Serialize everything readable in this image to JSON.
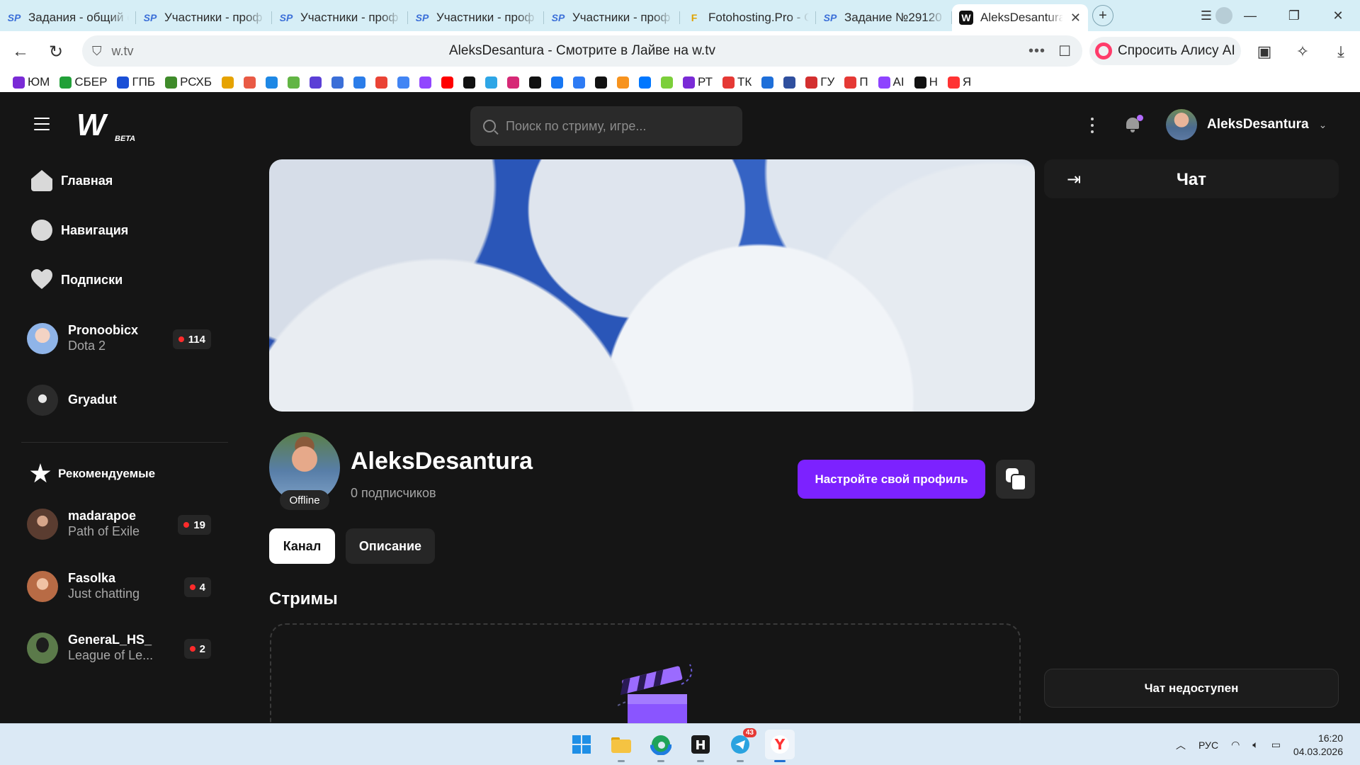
{
  "browser": {
    "tabs": [
      {
        "title": "Задания - общий с",
        "favicon": "SP",
        "active": false
      },
      {
        "title": "Участники - проф",
        "favicon": "SP",
        "active": false
      },
      {
        "title": "Участники - проф",
        "favicon": "SP",
        "active": false
      },
      {
        "title": "Участники - проф",
        "favicon": "SP",
        "active": false
      },
      {
        "title": "Участники - проф",
        "favicon": "SP",
        "active": false
      },
      {
        "title": "Fotohosting.Pro - С",
        "favicon": "F",
        "active": false
      },
      {
        "title": "Задание №29120",
        "favicon": "SP",
        "active": false
      },
      {
        "title": "AleksDesantura",
        "favicon": "W",
        "active": true
      }
    ],
    "new_tab": "+",
    "url": "w.tv",
    "page_title": "AleksDesantura - Смотрите в Лайве на w.tv",
    "alice_label": "Спросить Алису AI",
    "bookmarks": [
      {
        "label": "ЮМ",
        "color": "#7a2bd6"
      },
      {
        "label": "СБЕР",
        "color": "#21a038"
      },
      {
        "label": "ГПБ",
        "color": "#1a4fd6"
      },
      {
        "label": "РСХБ",
        "color": "#3f8b2a"
      },
      {
        "label": "",
        "color": "#e6a300"
      },
      {
        "label": "",
        "color": "#e95a45"
      },
      {
        "label": "",
        "color": "#1e88e5"
      },
      {
        "label": "",
        "color": "#62b544"
      },
      {
        "label": "",
        "color": "#5b3fd6"
      },
      {
        "label": "",
        "color": "#3b6fd8"
      },
      {
        "label": "",
        "color": "#2b7de9"
      },
      {
        "label": "",
        "color": "#ea4335"
      },
      {
        "label": "",
        "color": "#4285f4"
      },
      {
        "label": "",
        "color": "#9146ff"
      },
      {
        "label": "",
        "color": "#ff0000"
      },
      {
        "label": "",
        "color": "#111111"
      },
      {
        "label": "",
        "color": "#2ea6e6"
      },
      {
        "label": "",
        "color": "#d62976"
      },
      {
        "label": "",
        "color": "#111111"
      },
      {
        "label": "",
        "color": "#1877f2"
      },
      {
        "label": "",
        "color": "#2d7bf4"
      },
      {
        "label": "",
        "color": "#111111"
      },
      {
        "label": "",
        "color": "#f7931e"
      },
      {
        "label": "",
        "color": "#0077ff"
      },
      {
        "label": "",
        "color": "#7ccf3a"
      },
      {
        "label": "РТ",
        "color": "#7a2bd6"
      },
      {
        "label": "ТК",
        "color": "#e53935"
      },
      {
        "label": "",
        "color": "#1e6fd9"
      },
      {
        "label": "",
        "color": "#2f4f9e"
      },
      {
        "label": "ГУ",
        "color": "#d32f2f"
      },
      {
        "label": "П",
        "color": "#e53935"
      },
      {
        "label": "AI",
        "color": "#8e44ff"
      },
      {
        "label": "Н",
        "color": "#111111"
      },
      {
        "label": "Я",
        "color": "#ff3333"
      }
    ]
  },
  "site": {
    "logo_beta": "BETA",
    "search_placeholder": "Поиск по стриму, игре...",
    "username": "AleksDesantura"
  },
  "sidebar": {
    "nav": [
      {
        "label": "Главная",
        "icon": "home-icon"
      },
      {
        "label": "Навигация",
        "icon": "compass-icon"
      },
      {
        "label": "Подписки",
        "icon": "heart-icon"
      }
    ],
    "follows": [
      {
        "name": "Pronoobicx",
        "game": "Dota 2",
        "viewers": "114",
        "avatar_color": "#8fb4e8"
      },
      {
        "name": "Gryadut",
        "game": "",
        "viewers": "",
        "avatar_color": "#2b2b2b"
      }
    ],
    "recommended_label": "Рекомендуемые",
    "recommended": [
      {
        "name": "madarapoe",
        "game": "Path of Exile",
        "viewers": "19",
        "avatar_color": "#7a4f3a"
      },
      {
        "name": "Fasolka",
        "game": "Just chatting",
        "viewers": "4",
        "avatar_color": "#c98a6a"
      },
      {
        "name": "GeneraL_HS_",
        "game": "League of Le...",
        "viewers": "2",
        "avatar_color": "#3e5a36"
      }
    ]
  },
  "profile": {
    "name": "AleksDesantura",
    "status": "Offline",
    "subscribers": "0 подписчиков",
    "setup_button": "Настройте свой профиль",
    "tabs": [
      "Канал",
      "Описание"
    ],
    "streams_heading": "Стримы"
  },
  "chat": {
    "title": "Чат",
    "unavailable": "Чат недоступен"
  },
  "taskbar": {
    "telegram_badge": "43",
    "language": "РУС",
    "time": "16:20",
    "date": "04.03.2026"
  }
}
